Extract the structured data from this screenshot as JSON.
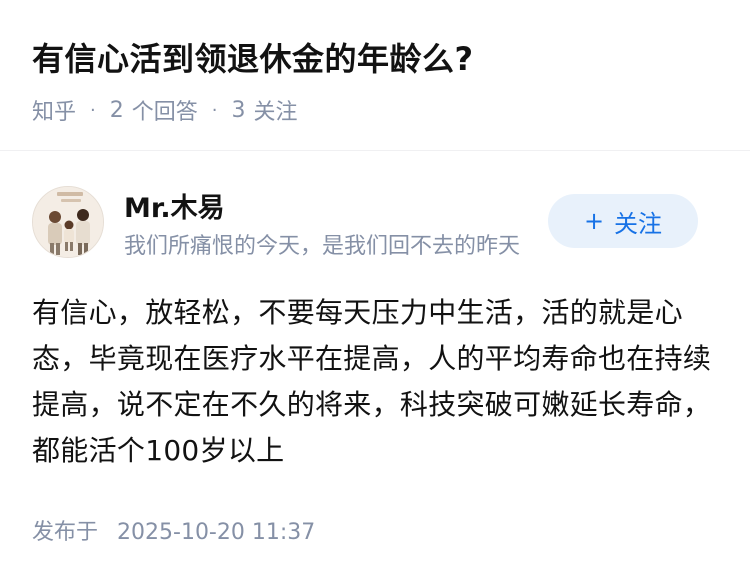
{
  "question": {
    "title": "有信心活到领退休金的年龄么?",
    "source": "知乎",
    "separator": "·",
    "answer_count": "2",
    "answer_label": "个回答",
    "follow_count": "3",
    "follow_label": "关注"
  },
  "author": {
    "avatar_icon": "avatar-family-photo",
    "name": "Mr.木易",
    "bio": "我们所痛恨的今天，是我们回不去的昨天",
    "follow_button": {
      "icon": "plus-icon",
      "icon_glyph": "+",
      "label": "关注"
    }
  },
  "answer": {
    "text": "有信心，放轻松，不要每天压力中生活，活的就是心态，毕竟现在医疗水平在提高，人的平均寿命也在持续提高，说不定在不久的将来，科技突破可嫩延长寿命，都能活个100岁以上",
    "published_label": "发布于",
    "published_time": "2025-10-20 11:37"
  },
  "colors": {
    "title": "#121212",
    "meta": "#8590a6",
    "accent": "#1772e6",
    "follow_bg": "#e8f1fb"
  }
}
